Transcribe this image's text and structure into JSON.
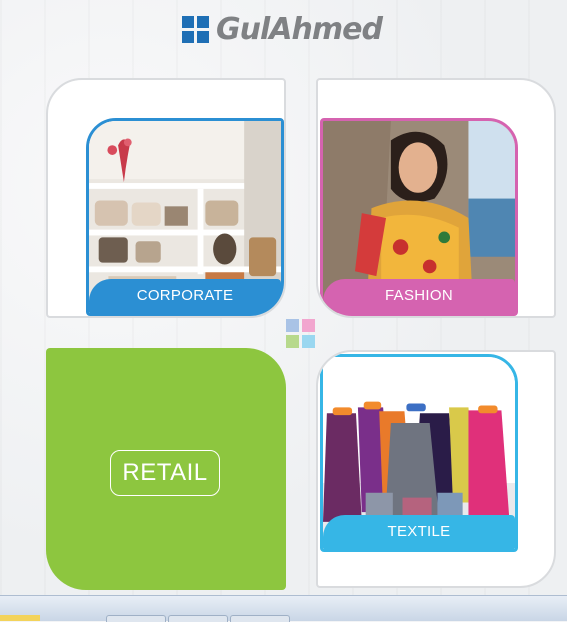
{
  "brand": {
    "logo_text": "GulAhmed",
    "logo_color": "#1f6fb5"
  },
  "cards": {
    "corporate": {
      "label": "CORPORATE",
      "accent": "#2b8fd3"
    },
    "fashion": {
      "label": "FASHION",
      "accent": "#d563b0"
    },
    "retail": {
      "label": "RETAIL",
      "accent": "#8dc63f"
    },
    "textile": {
      "label": "TEXTILE",
      "accent": "#36b6e6"
    }
  },
  "center_squares_colors": [
    "#a9c3e6",
    "#f2a6cf",
    "#b7d98c",
    "#9ad7f0"
  ]
}
